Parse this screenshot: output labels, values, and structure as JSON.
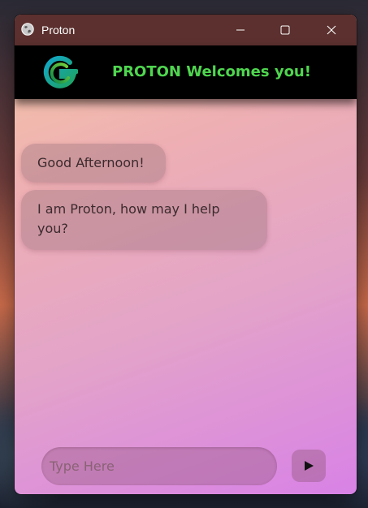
{
  "window": {
    "title": "Proton",
    "controls": {
      "minimize_icon": "minimize-icon",
      "maximize_icon": "maximize-icon",
      "close_icon": "close-icon"
    }
  },
  "header": {
    "logo_icon": "proton-logo-icon",
    "title": "PROTON Welcomes you!",
    "title_color": "#4fd64f",
    "background": "#000000"
  },
  "messages": [
    {
      "text": "Good Afternoon!"
    },
    {
      "text": "I am Proton, how may I help you?"
    }
  ],
  "composer": {
    "value": "",
    "placeholder": "Type Here",
    "send_icon": "play-icon"
  },
  "colors": {
    "titlebar": "#5b302e",
    "gradient_start": "#f6c9a6",
    "gradient_end": "#d882e6"
  }
}
